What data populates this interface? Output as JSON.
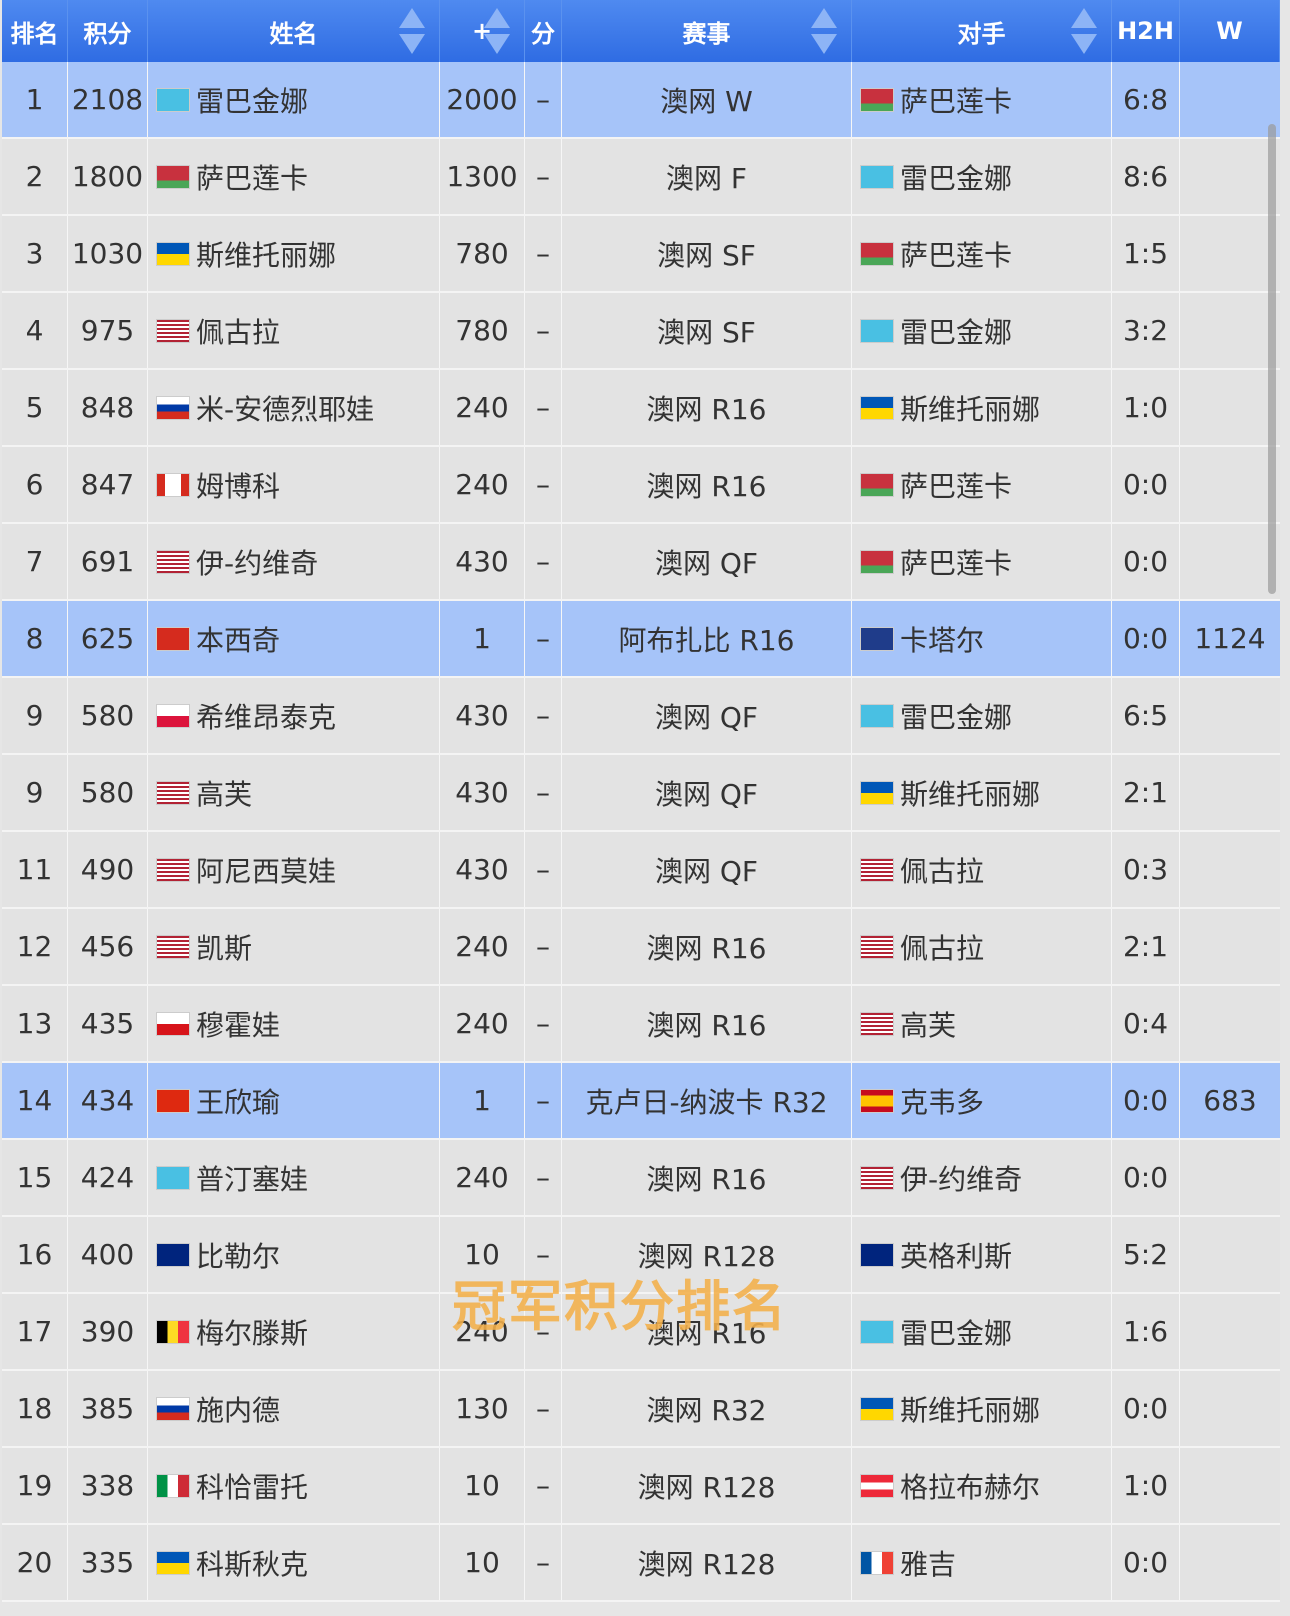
{
  "colors": {
    "highlight": "#a6c4f9",
    "header": "#3a76e8",
    "watermark": "#f4b04a"
  },
  "columns": [
    "排名",
    "积分",
    "姓名",
    "+",
    "分",
    "赛事",
    "对手",
    "H2H",
    "W"
  ],
  "sortable_icon": "sort-arrows-icon",
  "watermark": "冠军积分排名",
  "rows": [
    {
      "rank": "1",
      "points": "2108",
      "flag": "kz",
      "name": "雷巴金娜",
      "plus": "2000",
      "minus": "–",
      "event": "澳网 W",
      "opp_flag": "by",
      "opponent": "萨巴莲卡",
      "h2h": "6:8",
      "w": "",
      "hl": true
    },
    {
      "rank": "2",
      "points": "1800",
      "flag": "by",
      "name": "萨巴莲卡",
      "plus": "1300",
      "minus": "–",
      "event": "澳网 F",
      "opp_flag": "kz",
      "opponent": "雷巴金娜",
      "h2h": "8:6",
      "w": ""
    },
    {
      "rank": "3",
      "points": "1030",
      "flag": "ua",
      "name": "斯维托丽娜",
      "plus": "780",
      "minus": "–",
      "event": "澳网 SF",
      "opp_flag": "by",
      "opponent": "萨巴莲卡",
      "h2h": "1:5",
      "w": ""
    },
    {
      "rank": "4",
      "points": "975",
      "flag": "us",
      "name": "佩古拉",
      "plus": "780",
      "minus": "–",
      "event": "澳网 SF",
      "opp_flag": "kz",
      "opponent": "雷巴金娜",
      "h2h": "3:2",
      "w": ""
    },
    {
      "rank": "5",
      "points": "848",
      "flag": "ru",
      "name": "米-安德烈耶娃",
      "plus": "240",
      "minus": "–",
      "event": "澳网 R16",
      "opp_flag": "ua",
      "opponent": "斯维托丽娜",
      "h2h": "1:0",
      "w": ""
    },
    {
      "rank": "6",
      "points": "847",
      "flag": "ca",
      "name": "姆博科",
      "plus": "240",
      "minus": "–",
      "event": "澳网 R16",
      "opp_flag": "by",
      "opponent": "萨巴莲卡",
      "h2h": "0:0",
      "w": ""
    },
    {
      "rank": "7",
      "points": "691",
      "flag": "us",
      "name": "伊-约维奇",
      "plus": "430",
      "minus": "–",
      "event": "澳网 QF",
      "opp_flag": "by",
      "opponent": "萨巴莲卡",
      "h2h": "0:0",
      "w": ""
    },
    {
      "rank": "8",
      "points": "625",
      "flag": "ch",
      "name": "本西奇",
      "plus": "1",
      "minus": "–",
      "event": "阿布扎比 R16",
      "opp_flag": "gb",
      "opponent": "卡塔尔",
      "h2h": "0:0",
      "w": "1124",
      "hl": true
    },
    {
      "rank": "9",
      "points": "580",
      "flag": "pl",
      "name": "希维昂泰克",
      "plus": "430",
      "minus": "–",
      "event": "澳网 QF",
      "opp_flag": "kz",
      "opponent": "雷巴金娜",
      "h2h": "6:5",
      "w": ""
    },
    {
      "rank": "9",
      "points": "580",
      "flag": "us",
      "name": "高芙",
      "plus": "430",
      "minus": "–",
      "event": "澳网 QF",
      "opp_flag": "ua",
      "opponent": "斯维托丽娜",
      "h2h": "2:1",
      "w": ""
    },
    {
      "rank": "11",
      "points": "490",
      "flag": "us",
      "name": "阿尼西莫娃",
      "plus": "430",
      "minus": "–",
      "event": "澳网 QF",
      "opp_flag": "us",
      "opponent": "佩古拉",
      "h2h": "0:3",
      "w": ""
    },
    {
      "rank": "12",
      "points": "456",
      "flag": "us",
      "name": "凯斯",
      "plus": "240",
      "minus": "–",
      "event": "澳网 R16",
      "opp_flag": "us",
      "opponent": "佩古拉",
      "h2h": "2:1",
      "w": ""
    },
    {
      "rank": "13",
      "points": "435",
      "flag": "cz",
      "name": "穆霍娃",
      "plus": "240",
      "minus": "–",
      "event": "澳网 R16",
      "opp_flag": "us",
      "opponent": "高芙",
      "h2h": "0:4",
      "w": ""
    },
    {
      "rank": "14",
      "points": "434",
      "flag": "cn",
      "name": "王欣瑜",
      "plus": "1",
      "minus": "–",
      "event": "克卢日-纳波卡 R32",
      "opp_flag": "es",
      "opponent": "克韦多",
      "h2h": "0:0",
      "w": "683",
      "hl": true
    },
    {
      "rank": "15",
      "points": "424",
      "flag": "kz",
      "name": "普汀塞娃",
      "plus": "240",
      "minus": "–",
      "event": "澳网 R16",
      "opp_flag": "us",
      "opponent": "伊-约维奇",
      "h2h": "0:0",
      "w": ""
    },
    {
      "rank": "16",
      "points": "400",
      "flag": "au",
      "name": "比勒尔",
      "plus": "10",
      "minus": "–",
      "event": "澳网 R128",
      "opp_flag": "au",
      "opponent": "英格利斯",
      "h2h": "5:2",
      "w": ""
    },
    {
      "rank": "17",
      "points": "390",
      "flag": "be",
      "name": "梅尔滕斯",
      "plus": "240",
      "minus": "–",
      "event": "澳网 R16",
      "opp_flag": "kz",
      "opponent": "雷巴金娜",
      "h2h": "1:6",
      "w": ""
    },
    {
      "rank": "18",
      "points": "385",
      "flag": "ru",
      "name": "施内德",
      "plus": "130",
      "minus": "–",
      "event": "澳网 R32",
      "opp_flag": "ua",
      "opponent": "斯维托丽娜",
      "h2h": "0:0",
      "w": ""
    },
    {
      "rank": "19",
      "points": "338",
      "flag": "it",
      "name": "科恰雷托",
      "plus": "10",
      "minus": "–",
      "event": "澳网 R128",
      "opp_flag": "at",
      "opponent": "格拉布赫尔",
      "h2h": "1:0",
      "w": ""
    },
    {
      "rank": "20",
      "points": "335",
      "flag": "ua",
      "name": "科斯秋克",
      "plus": "10",
      "minus": "–",
      "event": "澳网 R128",
      "opp_flag": "fr",
      "opponent": "雅吉",
      "h2h": "0:0",
      "w": ""
    }
  ]
}
